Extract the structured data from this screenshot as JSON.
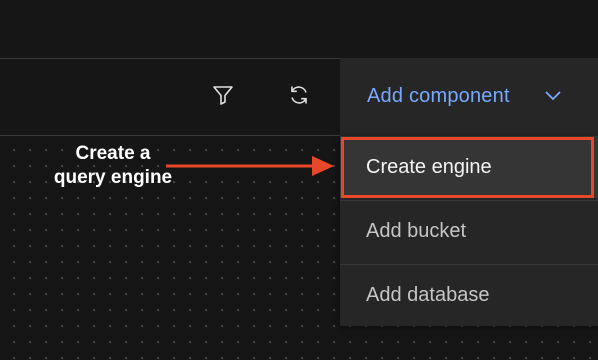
{
  "toolbar": {
    "filter_icon": "filter-icon",
    "refresh_icon": "refresh-icon",
    "add_component_label": "Add component",
    "chevron_icon": "chevron-down-icon",
    "accent_color": "#78a9ff"
  },
  "menu": {
    "items": [
      {
        "label": "Create engine",
        "highlighted": true
      },
      {
        "label": "Add bucket"
      },
      {
        "label": "Add database"
      }
    ]
  },
  "annotation": {
    "callout_text": "Create a query engine",
    "color": "#e8472a"
  }
}
